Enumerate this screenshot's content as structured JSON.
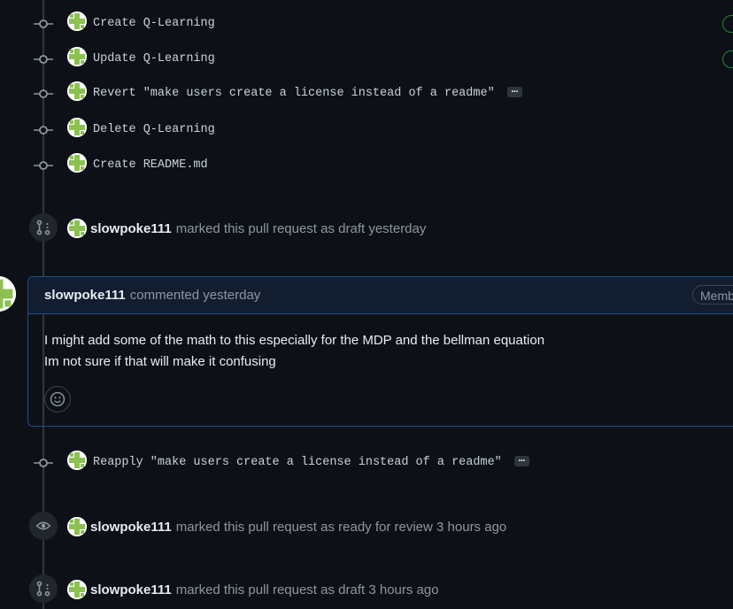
{
  "commits_top": [
    {
      "message": "Create Q-Learning",
      "verified": true
    },
    {
      "message": "Update Q-Learning",
      "verified": true
    },
    {
      "message": "Revert \"make users create a license instead of a readme\"",
      "ellipsis": "…"
    },
    {
      "message": "Delete Q-Learning"
    },
    {
      "message": "Create README.md"
    }
  ],
  "event_draft_1": {
    "author": "slowpoke111",
    "text": "marked this pull request as draft yesterday"
  },
  "comment": {
    "author": "slowpoke111",
    "when": "commented yesterday",
    "badge": "Member",
    "lines": [
      "I might add some of the math to this especially for the MDP and the bellman equation",
      "Im not sure if that will make it confusing"
    ]
  },
  "commit_reapply": {
    "message": "Reapply \"make users create a license instead of a readme\"",
    "ellipsis": "…"
  },
  "event_ready": {
    "author": "slowpoke111",
    "text": "marked this pull request as ready for review 3 hours ago"
  },
  "event_draft_2": {
    "author": "slowpoke111",
    "text": "marked this pull request as draft 3 hours ago"
  },
  "colors": {
    "background": "#0d1117",
    "accent_border": "#1f4e8a",
    "verified_green": "#3fb950",
    "muted": "#8d96a0"
  },
  "icons": [
    "commit-icon",
    "pull-request-draft-icon",
    "eye-icon",
    "smiley-icon",
    "avatar-identicon"
  ]
}
